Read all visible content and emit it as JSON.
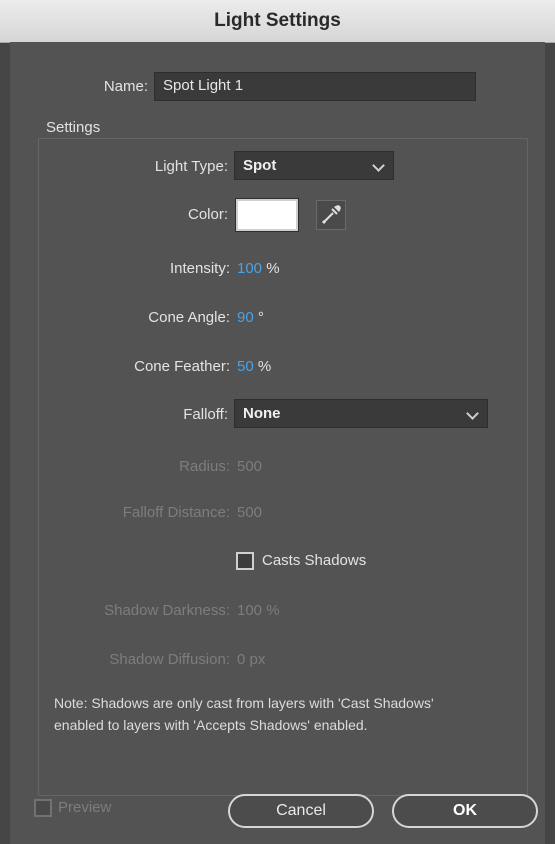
{
  "window": {
    "title": "Light Settings"
  },
  "name_field": {
    "label": "Name:",
    "value": "Spot Light 1"
  },
  "settings_group": {
    "label": "Settings"
  },
  "light_type": {
    "label": "Light Type:",
    "selected": "Spot"
  },
  "color": {
    "label": "Color:",
    "value": "#ffffff",
    "picker_icon": "eyedropper-icon"
  },
  "intensity": {
    "label": "Intensity:",
    "value": "100",
    "unit": "%"
  },
  "cone_angle": {
    "label": "Cone Angle:",
    "value": "90",
    "unit": "°"
  },
  "cone_feather": {
    "label": "Cone Feather:",
    "value": "50",
    "unit": "%"
  },
  "falloff": {
    "label": "Falloff:",
    "selected": "None"
  },
  "radius": {
    "label": "Radius:",
    "value": "500"
  },
  "falloff_distance": {
    "label": "Falloff Distance:",
    "value": "500"
  },
  "casts_shadows": {
    "label": "Casts Shadows",
    "checked": false
  },
  "shadow_darkness": {
    "label": "Shadow Darkness:",
    "value": "100 %"
  },
  "shadow_diffusion": {
    "label": "Shadow Diffusion:",
    "value": "0 px"
  },
  "note": {
    "line1": "Note: Shadows are only cast from layers with 'Cast Shadows'",
    "line2": "enabled to layers with 'Accepts Shadows' enabled."
  },
  "footer": {
    "preview_label": "Preview",
    "cancel_label": "Cancel",
    "ok_label": "OK"
  },
  "colors": {
    "accent_value": "#4aa3e6",
    "dialog_bg": "#535353",
    "field_bg": "#3a3a3a"
  }
}
